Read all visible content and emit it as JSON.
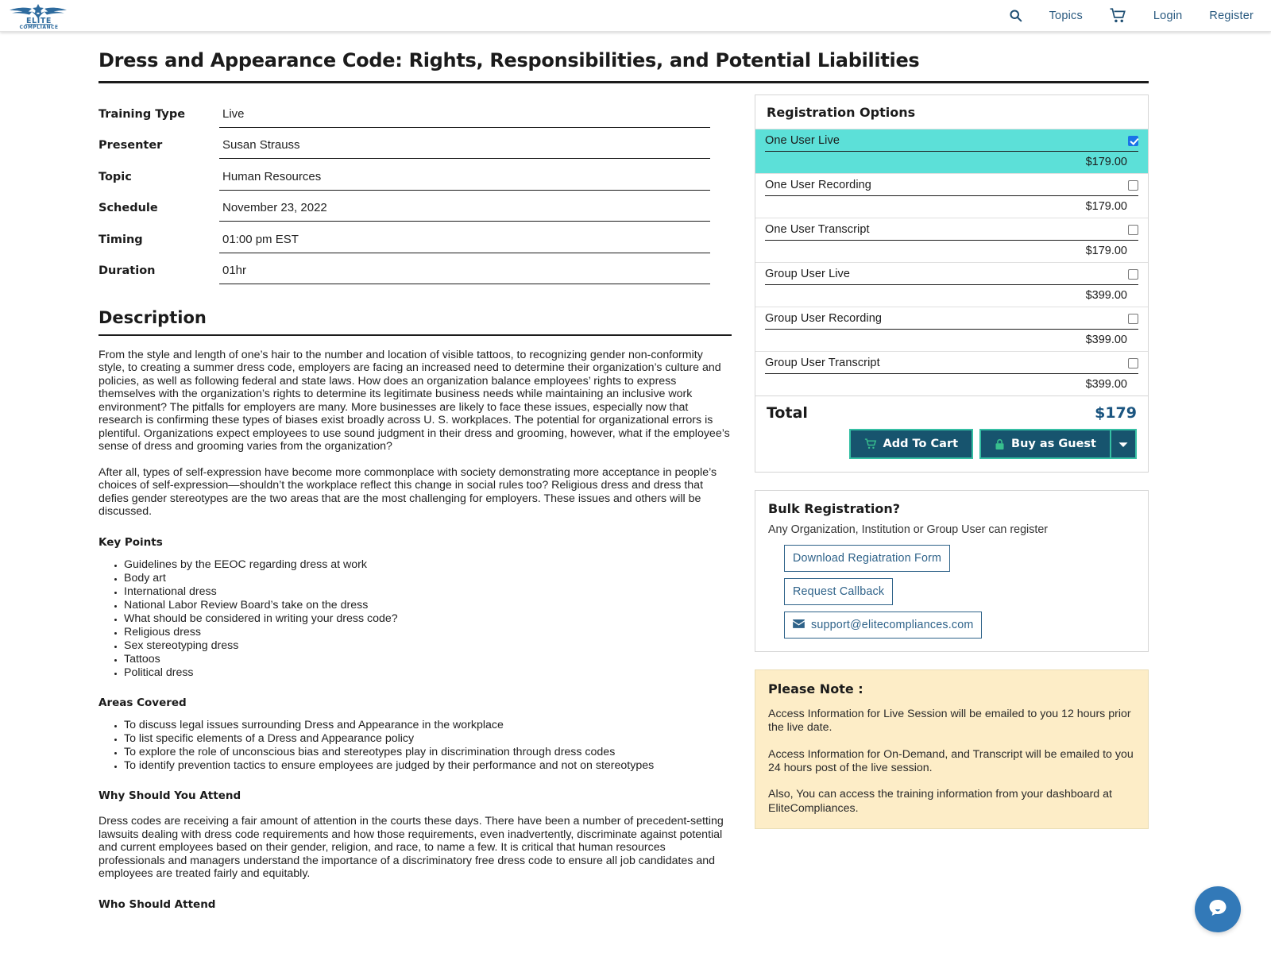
{
  "header": {
    "logo_line1": "ELITE",
    "logo_line2": "COMPLIANCE",
    "nav": [
      {
        "name": "search-icon",
        "label": ""
      },
      {
        "name": "topics",
        "label": "Topics"
      },
      {
        "name": "cart-icon",
        "label": ""
      },
      {
        "name": "login",
        "label": "Login"
      },
      {
        "name": "register",
        "label": "Register"
      }
    ],
    "topics_label": "Topics",
    "login_label": "Login",
    "register_label": "Register"
  },
  "page_title": "Dress and Appearance Code: Rights, Responsibilities, and Potential Liabilities",
  "details": [
    {
      "label": "Training Type",
      "value": "Live"
    },
    {
      "label": "Presenter",
      "value": "Susan Strauss"
    },
    {
      "label": "Topic",
      "value": "Human Resources"
    },
    {
      "label": "Schedule",
      "value": "November 23, 2022"
    },
    {
      "label": "Timing",
      "value": "01:00 pm EST"
    },
    {
      "label": "Duration",
      "value": "01hr"
    }
  ],
  "description": {
    "heading": "Description",
    "paragraph1": "From the style and length of one’s hair to the number and location of visible tattoos, to recognizing gender non-conformity style, to creating a summer dress code, employers are facing an increased need to determine their organization’s culture and policies, as well as following federal and state laws. How does an organization balance employees’ rights to express themselves with the organization’s rights to determine its legitimate business needs while maintaining an inclusive work environment? The pitfalls for employers are many. More businesses are likely to face these issues, especially now that research is confirming these types of biases exist broadly across U. S. workplaces. The potential for organizational errors is plentiful. Organizations expect employees to use sound judgment in their dress and grooming, however, what if the employee’s sense of dress and grooming varies from the organization?",
    "paragraph2": "After all, types of self-expression have become more commonplace with society demonstrating more acceptance in people’s choices of self-expression—shouldn’t the workplace reflect this change in social rules too? Religious dress and dress that defies gender stereotypes are the two areas that are the most challenging for employers. These issues and others will be discussed."
  },
  "key_points": {
    "heading": "Key Points",
    "items": [
      "Guidelines by the EEOC regarding dress at work",
      "Body art",
      "International dress",
      "National Labor Review Board’s take on the dress",
      "What should be considered in writing your dress code?",
      "Religious dress",
      "Sex stereotyping dress",
      "Tattoos",
      "Political dress"
    ]
  },
  "areas_covered": {
    "heading": "Areas Covered",
    "items": [
      "To discuss legal issues surrounding Dress and Appearance in the workplace",
      "To list specific elements of a Dress and Appearance policy",
      "To explore the role of unconscious bias and stereotypes play in discrimination through dress codes",
      "To identify prevention tactics to ensure employees are judged by their performance and not on stereotypes"
    ]
  },
  "why_attend": {
    "heading": "Why Should You Attend",
    "paragraph": "Dress codes are receiving a fair amount of attention in the courts these days. There have been a number of precedent-setting lawsuits dealing with dress code requirements and how those requirements, even inadvertently, discriminate against potential and current employees based on their gender, religion, and race, to name a few. It is critical that human resources professionals and managers understand the importance of a discriminatory free dress code to ensure all job candidates and employees are treated fairly and equitably."
  },
  "who_attend": {
    "heading": "Who Should Attend"
  },
  "registration": {
    "title": "Registration Options",
    "options": [
      {
        "label": "One User Live",
        "price": "$179.00",
        "checked": true
      },
      {
        "label": "One User Recording",
        "price": "$179.00",
        "checked": false
      },
      {
        "label": "One User Transcript",
        "price": "$179.00",
        "checked": false
      },
      {
        "label": "Group User Live",
        "price": "$399.00",
        "checked": false
      },
      {
        "label": "Group User Recording",
        "price": "$399.00",
        "checked": false
      },
      {
        "label": "Group User Transcript",
        "price": "$399.00",
        "checked": false
      }
    ],
    "total_label": "Total",
    "total_value": "$179",
    "add_to_cart_label": "Add To Cart",
    "buy_as_guest_label": "Buy as Guest"
  },
  "bulk": {
    "title": "Bulk Registration?",
    "subtitle": "Any Organization, Institution or Group User can register",
    "download_label": "Download Regiatration Form",
    "callback_label": "Request Callback",
    "email_label": "support@elitecompliances.com"
  },
  "note": {
    "title": "Please Note :",
    "p1": "Access Information for Live Session will be emailed to you 12 hours prior the live date.",
    "p2": "Access Information for On-Demand, and Transcript will be emailed to you 24 hours post of the live session.",
    "p3": "Also, You can access the training information from your dashboard at EliteCompliances."
  },
  "colors": {
    "selected_row": "#5CE0D8",
    "brand_blue": "#28597f",
    "button_bg": "#17546e",
    "button_border": "#35bfa3",
    "note_bg": "#fdedc7",
    "chat_bubble": "#3279b8"
  }
}
